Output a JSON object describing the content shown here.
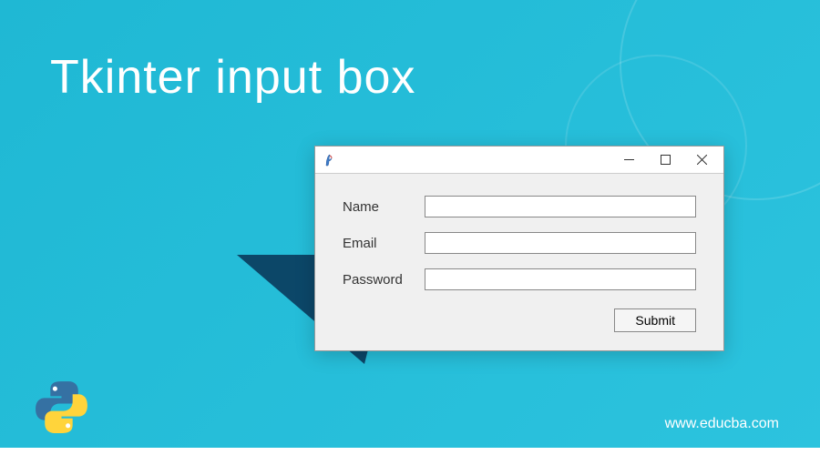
{
  "page_title": "Tkinter input box",
  "window": {
    "title": ""
  },
  "form": {
    "fields": [
      {
        "label": "Name",
        "value": ""
      },
      {
        "label": "Email",
        "value": ""
      },
      {
        "label": "Password",
        "value": ""
      }
    ],
    "submit_label": "Submit"
  },
  "footer": {
    "website": "www.educba.com"
  }
}
